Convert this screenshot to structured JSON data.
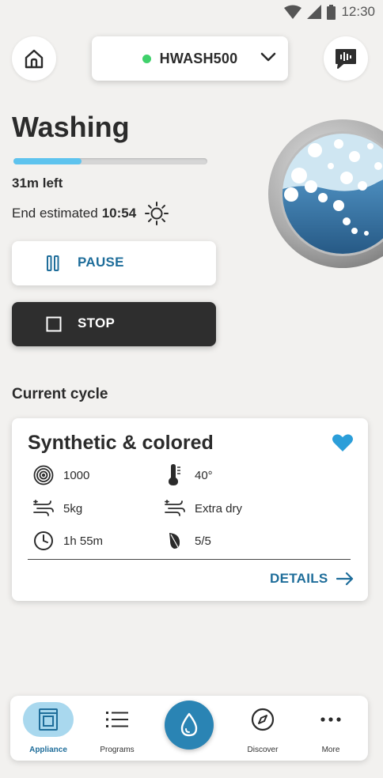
{
  "status_bar": {
    "time": "12:30"
  },
  "header": {
    "device_name": "HWASH500",
    "device_status_color": "#3fd16b"
  },
  "washing": {
    "state": "Washing",
    "progress_fraction": 0.35,
    "time_left": "31m left",
    "end_estimated_label": "End estimated",
    "end_estimated_time": "10:54"
  },
  "actions": {
    "pause_label": "PAUSE",
    "stop_label": "STOP"
  },
  "current_cycle": {
    "section_title": "Current cycle",
    "name": "Synthetic & colored",
    "favorite": true,
    "params": {
      "spin": {
        "icon": "spin-icon",
        "value": "1000"
      },
      "temperature": {
        "icon": "thermometer-icon",
        "value": "40°"
      },
      "load": {
        "icon": "dry-icon",
        "value": "5kg"
      },
      "dry": {
        "icon": "dry-icon",
        "value": "Extra dry"
      },
      "duration": {
        "icon": "clock-icon",
        "value": "1h 55m"
      },
      "eco": {
        "icon": "leaf-icon",
        "value": "5/5"
      }
    },
    "details_label": "DETAILS"
  },
  "bottom_nav": {
    "items": [
      {
        "label": "Appliance",
        "icon": "washer-icon",
        "active": true
      },
      {
        "label": "Programs",
        "icon": "list-icon",
        "active": false
      },
      {
        "label": "Discover",
        "icon": "compass-icon",
        "active": false
      },
      {
        "label": "More",
        "icon": "more-icon",
        "active": false
      }
    ],
    "center_action_icon": "water-drop-icon"
  },
  "colors": {
    "accent": "#1e6d9a",
    "progress": "#5ec3ee",
    "favorite": "#2b9ed9",
    "stop_button": "#2e2e2e",
    "fab": "#2a84b4"
  }
}
